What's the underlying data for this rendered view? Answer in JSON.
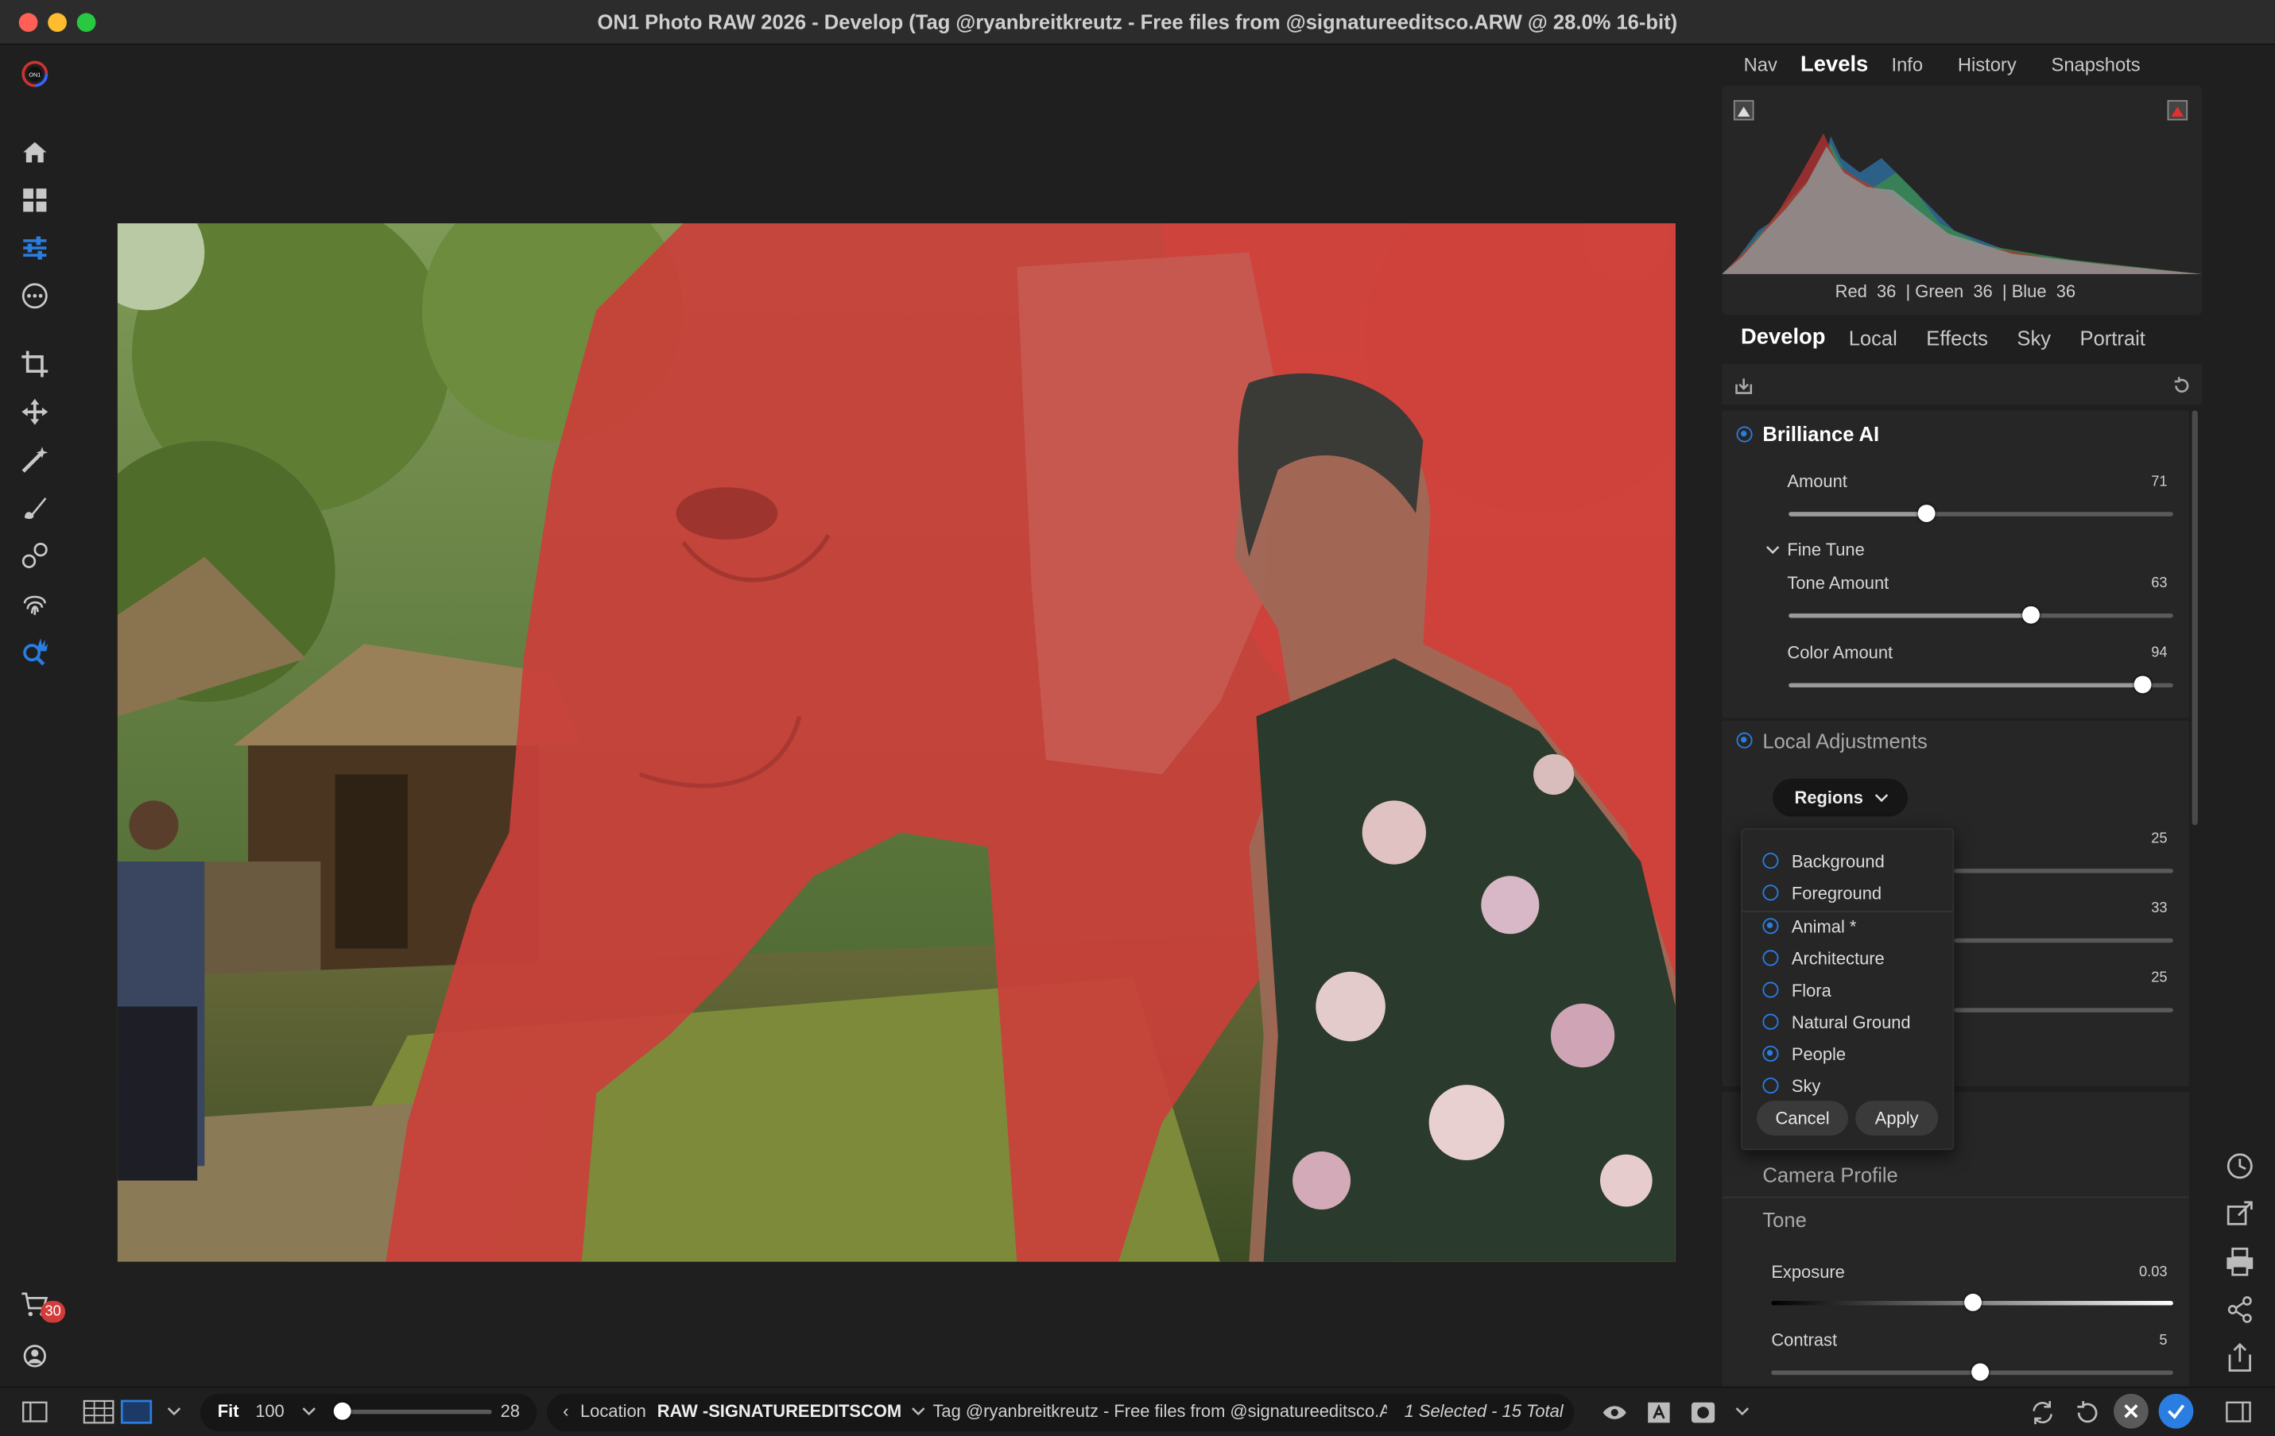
{
  "window": {
    "title": "ON1 Photo RAW 2026 - Develop (Tag @ryanbreitkreutz - Free files from @signatureeditsco.ARW @ 28.0% 16-bit)"
  },
  "left_tools": [
    {
      "name": "home-icon"
    },
    {
      "name": "grid-icon"
    },
    {
      "name": "sliders-icon"
    },
    {
      "name": "more-icon"
    },
    {
      "name": "crop-icon"
    },
    {
      "name": "move-icon"
    },
    {
      "name": "magic-wand-icon"
    },
    {
      "name": "brush-icon"
    },
    {
      "name": "blend-icon"
    },
    {
      "name": "fingerprint-icon"
    },
    {
      "name": "search-hand-icon"
    }
  ],
  "cart": {
    "badge": "30"
  },
  "top_tabs": {
    "items": [
      "Nav",
      "Levels",
      "Info",
      "History",
      "Snapshots"
    ],
    "active": "Levels"
  },
  "histogram": {
    "readout": {
      "red_label": "Red",
      "red": "36",
      "green_label": "| Green",
      "green": "36",
      "blue_label": "| Blue",
      "blue": "36"
    }
  },
  "develop_tabs": {
    "items": [
      "Develop",
      "Local",
      "Effects",
      "Sky",
      "Portrait"
    ],
    "active": "Develop"
  },
  "brilliance": {
    "title": "Brilliance AI",
    "amount_label": "Amount",
    "amount": "71",
    "amount_frac": 0.36,
    "fine_tune_label": "Fine Tune",
    "tone_label": "Tone Amount",
    "tone": "63",
    "tone_frac": 0.63,
    "color_label": "Color Amount",
    "color": "94",
    "color_frac": 0.92
  },
  "local_adjustments": {
    "title": "Local Adjustments",
    "regions_button": "Regions",
    "hidden_values": [
      "25",
      "33",
      "25"
    ]
  },
  "regions_menu": {
    "items": [
      {
        "label": "Background",
        "checked": false
      },
      {
        "label": "Foreground",
        "checked": false
      },
      {
        "label": "Animal *",
        "checked": true
      },
      {
        "label": "Architecture",
        "checked": false
      },
      {
        "label": "Flora",
        "checked": false
      },
      {
        "label": "Natural Ground",
        "checked": false
      },
      {
        "label": "People",
        "checked": true
      },
      {
        "label": "Sky",
        "checked": false
      }
    ],
    "cancel": "Cancel",
    "apply": "Apply"
  },
  "camera_profile": {
    "title": "Camera Profile"
  },
  "tone": {
    "title": "Tone",
    "exposure_label": "Exposure",
    "exposure": "0.03",
    "exposure_frac": 0.5,
    "contrast_label": "Contrast",
    "contrast": "5",
    "contrast_frac": 0.52
  },
  "bottom": {
    "fit": "Fit",
    "zoom": "100",
    "thumb_size": "28",
    "location_label": "Location",
    "location_value": "RAW -SIGNATUREEDITSCOM",
    "tag_text": "Tag @ryanbreitkreutz - Free files from @signatureeditsco.A",
    "selection": "1 Selected - 15 Total"
  },
  "colors": {
    "accent": "#2a7de1",
    "mask": "#d23a36",
    "badge": "#d43a3a"
  }
}
